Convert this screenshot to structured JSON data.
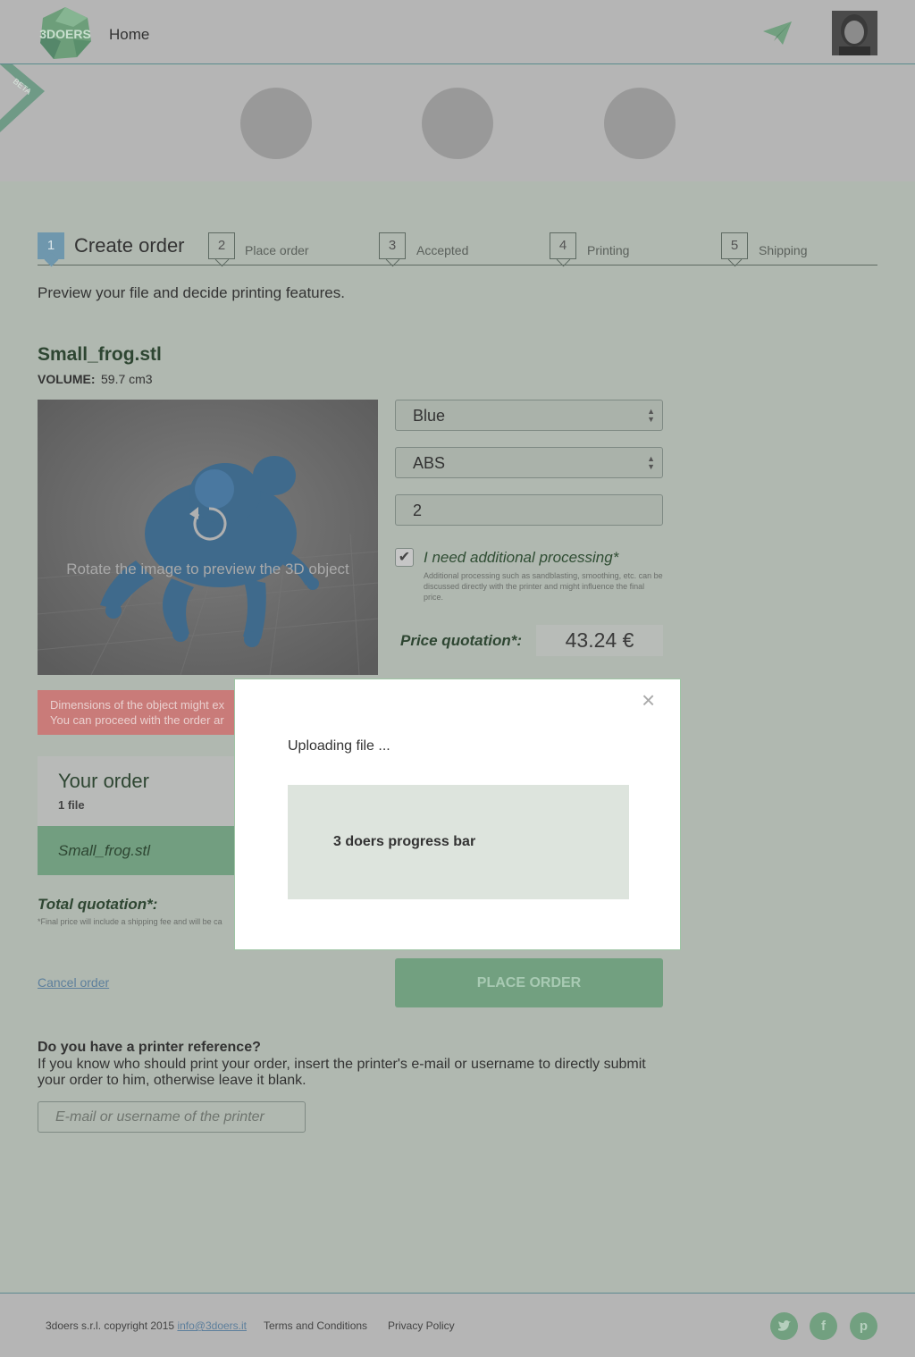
{
  "header": {
    "logo_text": "3DOERS",
    "home_label": "Home",
    "beta_label": "BETA"
  },
  "steps": [
    {
      "num": "1",
      "label": "Create order"
    },
    {
      "num": "2",
      "label": "Place order"
    },
    {
      "num": "3",
      "label": "Accepted"
    },
    {
      "num": "4",
      "label": "Printing"
    },
    {
      "num": "5",
      "label": "Shipping"
    }
  ],
  "intro": "Preview your file and decide printing features.",
  "file": {
    "name": "Small_frog.stl",
    "volume_label": "VOLUME:",
    "volume_value": "59.7 cm3"
  },
  "viewer": {
    "rotate_hint": "Rotate the image to preview the 3D object"
  },
  "form": {
    "color": "Blue",
    "material": "ABS",
    "quantity": "2",
    "processing_checked": true,
    "processing_label": "I need additional processing*",
    "processing_note": "Additional processing such as sandblasting, smoothing, etc. can be discussed directly with the printer and might influence the final price.",
    "price_label": "Price quotation*:",
    "price_value": "43.24 €"
  },
  "warning": {
    "line1": "Dimensions of the object might ex",
    "line2": "You can proceed with the order ar"
  },
  "order": {
    "title": "Your order",
    "count": "1 file",
    "file": "Small_frog.stl",
    "total_label": "Total quotation*:",
    "total_note": "*Final price will include a shipping fee and will be ca"
  },
  "actions": {
    "cancel": "Cancel order",
    "place_order": "PLACE ORDER"
  },
  "printer_ref": {
    "title": "Do you have a printer reference?",
    "description": "If you know who should print your order, insert the printer's e-mail or username to directly submit your order to him, otherwise leave it blank.",
    "placeholder": "E-mail or username of the printer"
  },
  "footer": {
    "copyright": "3doers s.r.l. copyright 2015",
    "email": "info@3doers.it",
    "terms": "Terms and Conditions",
    "privacy": "Privacy Policy"
  },
  "modal": {
    "close": "×",
    "title": "Uploading file ...",
    "progress_text": "3 doers progress bar"
  },
  "colors": {
    "brand_green": "#72a080",
    "step_active": "#6f97ad",
    "warning": "#c97b79"
  }
}
